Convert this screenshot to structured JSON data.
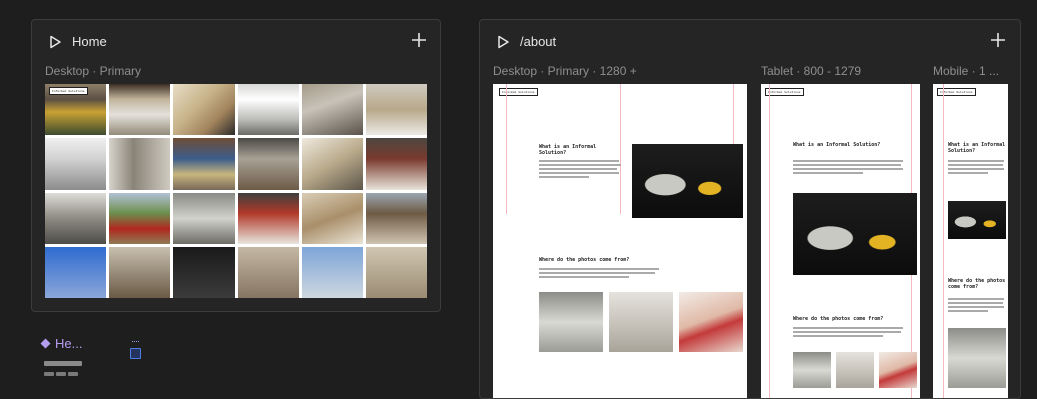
{
  "cards": [
    {
      "title": "Home",
      "frames": [
        {
          "label": "Desktop · Primary"
        }
      ]
    },
    {
      "title": "/about",
      "frames": [
        {
          "label": "Desktop · Primary · 1280 +"
        },
        {
          "label": "Tablet · 800 - 1279"
        },
        {
          "label": "Mobile · 1 ..."
        }
      ]
    }
  ],
  "preview": {
    "logo_text": "Informal Solutions",
    "heading1": "What is an Informal Solution?",
    "heading2": "Where do the photos come from?"
  },
  "component": {
    "name": "He..."
  },
  "icons": {
    "play": "play-icon",
    "add": "plus-icon",
    "component": "component-icon",
    "asset": "asset-icon"
  },
  "colors": {
    "background": "#1e1e1e",
    "card": "#252525",
    "border": "#3c3c3c",
    "component": "#b59df0",
    "guide": "#f4b8c0"
  }
}
